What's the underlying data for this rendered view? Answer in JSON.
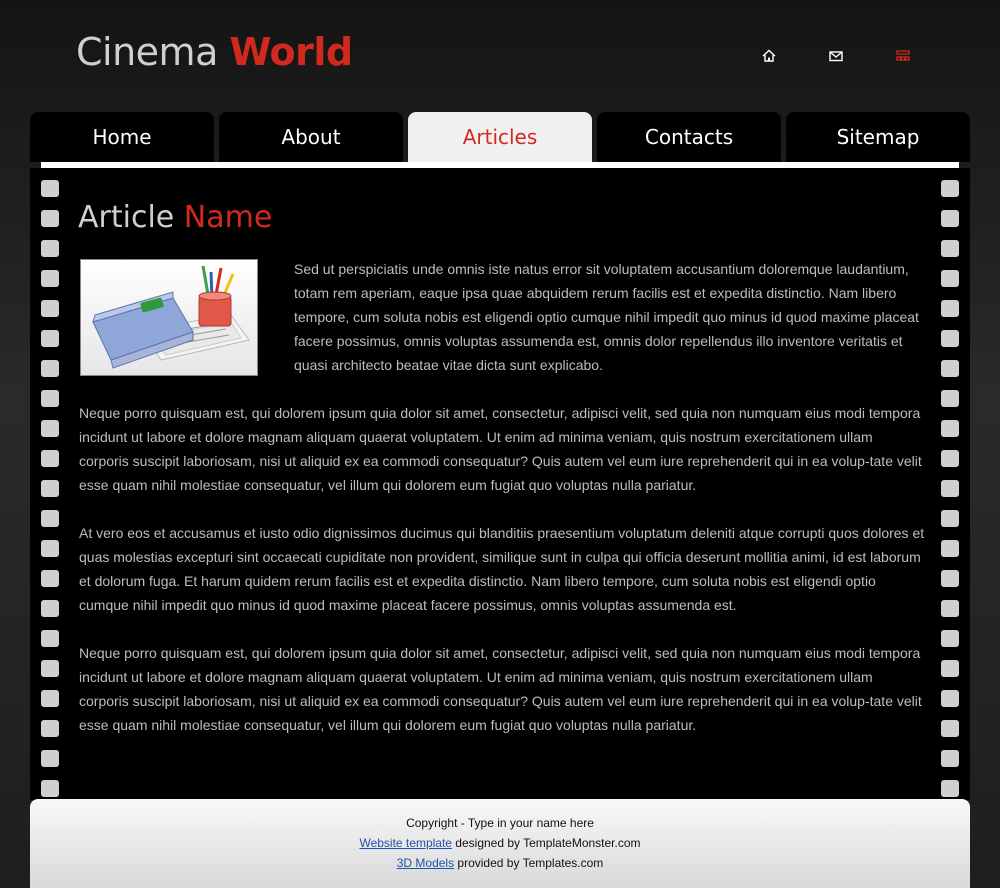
{
  "header": {
    "logo_part1": "Cinema",
    "logo_part2": "World",
    "icons": [
      "home-icon",
      "mail-icon",
      "sitemap-icon"
    ]
  },
  "nav": {
    "tabs": [
      {
        "label": "Home",
        "active": false
      },
      {
        "label": "About",
        "active": false
      },
      {
        "label": "Articles",
        "active": true
      },
      {
        "label": "Contacts",
        "active": false
      },
      {
        "label": "Sitemap",
        "active": false
      }
    ]
  },
  "article": {
    "title_part1": "Article",
    "title_part2": "Name",
    "image_alt": "office supplies folder",
    "para1": "Sed ut perspiciatis unde omnis iste natus error sit voluptatem accusantium doloremque laudantium, totam rem aperiam, eaque ipsa quae abquidem rerum facilis est et expedita distinctio. Nam libero tempore, cum soluta nobis est eligendi optio cumque nihil impedit quo minus id quod maxime placeat facere possimus, omnis voluptas assumenda est, omnis dolor repellendus  illo inventore veritatis et quasi architecto beatae vitae dicta sunt explicabo.",
    "para2": "Neque porro quisquam est, qui dolorem ipsum quia dolor sit amet, consectetur, adipisci velit, sed quia non numquam eius modi tempora incidunt ut labore et dolore magnam aliquam quaerat voluptatem. Ut enim ad minima veniam, quis nostrum exercitationem ullam corporis suscipit laboriosam, nisi ut aliquid ex ea commodi consequatur? Quis autem vel eum iure reprehenderit qui in ea volup-tate velit esse quam nihil molestiae consequatur, vel illum qui dolorem eum fugiat quo voluptas nulla pariatur.",
    "para3": "At vero eos et accusamus et iusto odio dignissimos ducimus qui blanditiis praesentium voluptatum deleniti atque corrupti quos dolores et quas molestias excepturi sint occaecati cupiditate non provident, similique sunt in culpa qui officia deserunt mollitia animi, id est laborum et dolorum fuga. Et harum quidem rerum facilis est et expedita distinctio. Nam libero tempore, cum soluta nobis est eligendi optio cumque nihil impedit quo minus id quod maxime placeat facere possimus, omnis voluptas assumenda est.",
    "para4": "Neque porro quisquam est, qui dolorem ipsum quia dolor sit amet, consectetur, adipisci velit, sed quia non numquam eius modi tempora incidunt ut labore et dolore magnam aliquam quaerat voluptatem. Ut enim ad minima veniam, quis nostrum exercitationem ullam corporis suscipit laboriosam, nisi ut aliquid ex ea commodi consequatur? Quis autem vel eum iure reprehenderit qui in ea volup-tate velit esse quam nihil molestiae consequatur, vel illum qui dolorem eum fugiat quo voluptas nulla pariatur."
  },
  "footer": {
    "copyright": "Copyright - Type in your name here",
    "link1": "Website template",
    "text1": " designed by TemplateMonster.com",
    "link2": "3D Models",
    "text2": " provided by Templates.com"
  },
  "colors": {
    "accent": "#d2291f",
    "background": "#1e1e1e",
    "panel": "#000000",
    "text": "#bdbdbd"
  }
}
